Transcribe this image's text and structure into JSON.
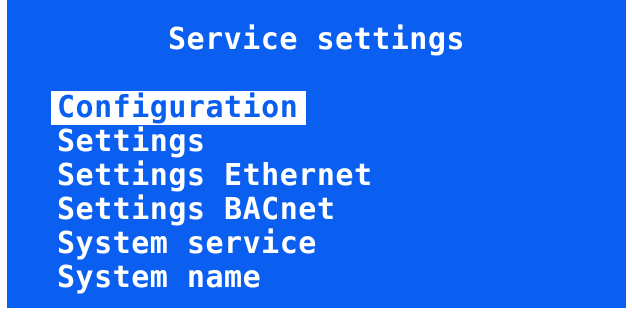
{
  "screen": {
    "title": "Service settings",
    "colors": {
      "background": "#0b5ff0",
      "text": "#ffffff",
      "highlight_bg": "#ffffff",
      "highlight_text": "#0b5ff0"
    }
  },
  "menu": {
    "items": [
      {
        "label": "Configuration",
        "selected": true
      },
      {
        "label": "Settings",
        "selected": false
      },
      {
        "label": "Settings Ethernet",
        "selected": false
      },
      {
        "label": "Settings BACnet",
        "selected": false
      },
      {
        "label": "System service",
        "selected": false
      },
      {
        "label": "System name",
        "selected": false
      }
    ]
  }
}
